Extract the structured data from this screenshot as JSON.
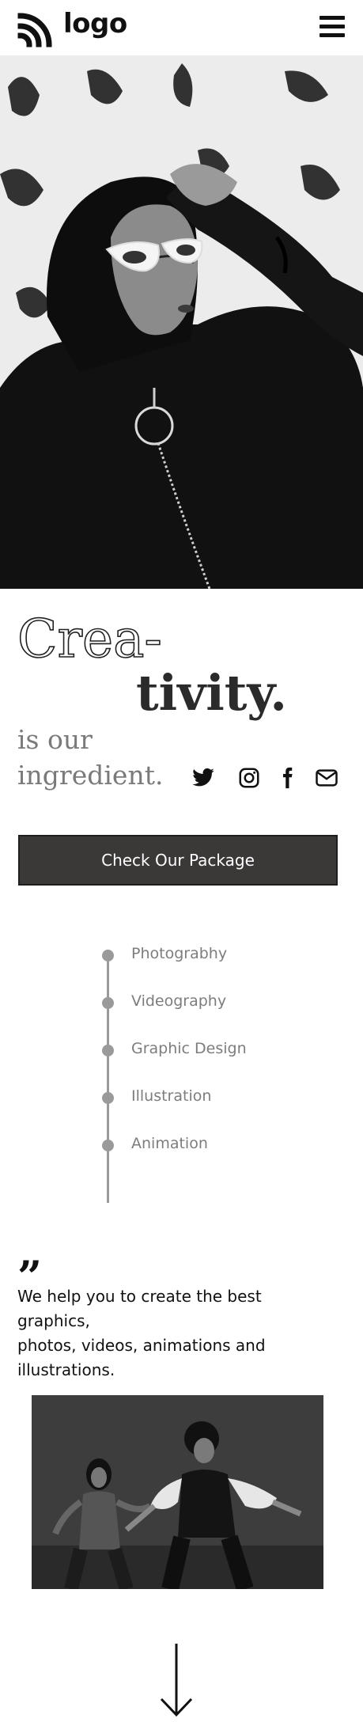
{
  "header": {
    "logo_text": "logo",
    "logo_icon": "logo-arcs-icon",
    "menu_icon": "hamburger-menu-icon"
  },
  "hero": {
    "image": "woman-in-hood-with-sunglasses-photo"
  },
  "headline": {
    "part1": "Crea-",
    "part2": "tivity.",
    "line1": "is our",
    "line2": "ingredient."
  },
  "social": {
    "icons": [
      "twitter-icon",
      "instagram-icon",
      "facebook-icon",
      "mail-icon"
    ]
  },
  "cta": {
    "label": "Check Our Package"
  },
  "services": {
    "items": [
      {
        "label": "Photograbhy"
      },
      {
        "label": "Videography"
      },
      {
        "label": "Graphic Design"
      },
      {
        "label": "Illustration"
      },
      {
        "label": "Animation"
      }
    ]
  },
  "quote": {
    "mark": "”",
    "line1": "We help you to create the best",
    "line2": "graphics,",
    "line3": "photos, videos, animations and",
    "line4": "illustrations."
  },
  "feature_image": "two-dancers-photo",
  "scroll_icon": "arrow-down-icon",
  "colors": {
    "button_bg": "#3b3838",
    "muted_text": "#7d7d7d",
    "timeline": "#9a9a9a"
  }
}
